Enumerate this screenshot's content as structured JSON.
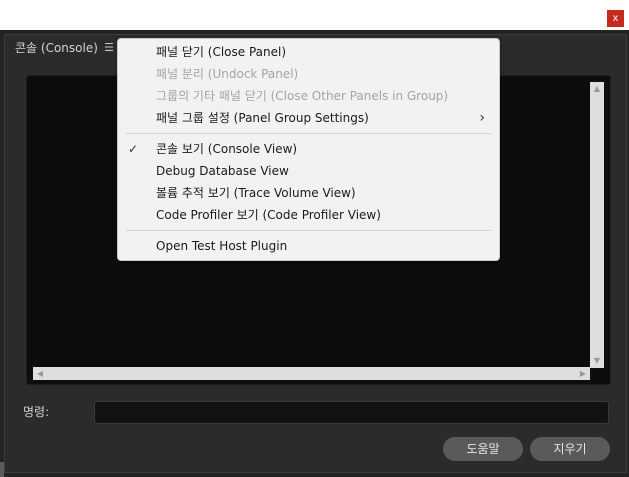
{
  "window": {
    "close_label": "x"
  },
  "panel": {
    "tab_label": "콘솔 (Console)",
    "menu_icon": "☰"
  },
  "console": {
    "scroll_up": "▲",
    "scroll_down": "▼",
    "scroll_left": "◀",
    "scroll_right": "▶"
  },
  "command": {
    "label": "명령:",
    "value": ""
  },
  "buttons": {
    "help": "도움말",
    "clear": "지우기"
  },
  "menu": {
    "items": [
      {
        "label": "패널 닫기 (Close Panel)",
        "enabled": true
      },
      {
        "label": "패널 분리 (Undock Panel)",
        "enabled": false
      },
      {
        "label": "그룹의 기타 패널 닫기 (Close Other Panels in Group)",
        "enabled": false
      },
      {
        "label": "패널 그룹 설정 (Panel Group Settings)",
        "enabled": true,
        "submenu_glyph": "›"
      },
      {
        "label": "콘솔 보기 (Console View)",
        "enabled": true,
        "check_glyph": "✓"
      },
      {
        "label": "Debug Database View",
        "enabled": true
      },
      {
        "label": "볼륨 추적 보기 (Trace Volume View)",
        "enabled": true
      },
      {
        "label": "Code Profiler 보기 (Code Profiler View)",
        "enabled": true
      },
      {
        "label": "Open Test Host Plugin",
        "enabled": true
      }
    ]
  },
  "colors": {
    "background": "#232323",
    "console_bg": "#0d0d0d",
    "button_bg": "#5a5a5a",
    "close_red": "#c42b1c",
    "menu_bg": "#f2f2f2",
    "disabled_text": "#a4a4a4"
  }
}
